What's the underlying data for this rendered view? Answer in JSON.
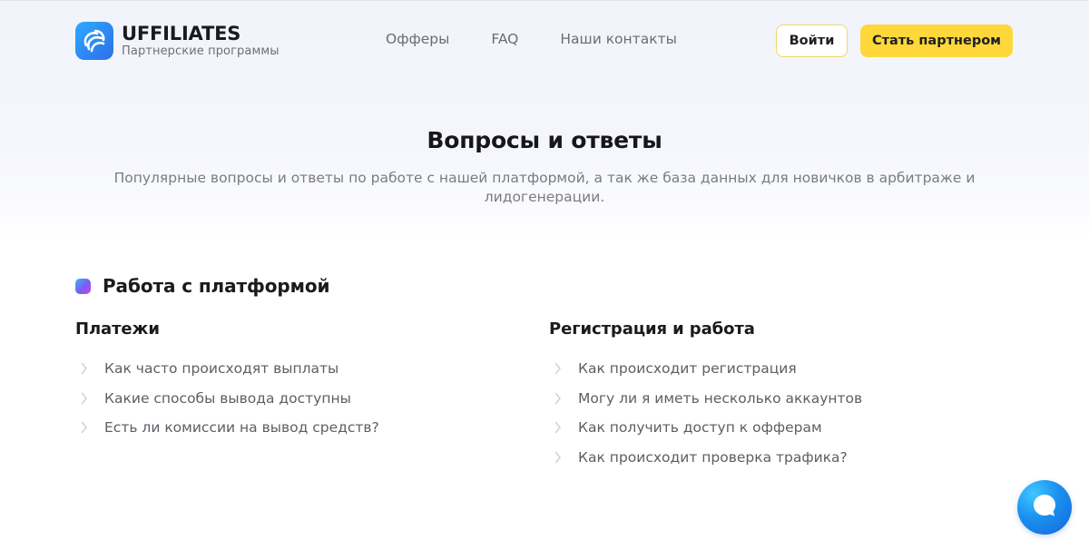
{
  "header": {
    "logo_title": "UFFILIATES",
    "logo_subtitle": "Партнерские программы",
    "nav": [
      "Офферы",
      "FAQ",
      "Наши контакты"
    ],
    "login_label": "Войти",
    "partner_label": "Стать партнером"
  },
  "hero": {
    "title": "Вопросы и ответы",
    "subtitle": "Популярные вопросы и ответы по работе с нашей платформой, а так же база данных для новичков в арбитраже и лидогенерации."
  },
  "section": {
    "title": "Работа с платформой",
    "columns": [
      {
        "title": "Платежи",
        "items": [
          "Как часто происходят выплаты",
          "Какие способы вывода доступны",
          "Есть ли комиссии на вывод средств?"
        ]
      },
      {
        "title": "Регистрация и работа",
        "items": [
          "Как происходит регистрация",
          "Могу ли я иметь несколько аккаунтов",
          "Как получить доступ к офферам",
          "Как происходит проверка трафика?"
        ]
      }
    ]
  },
  "icons": {
    "logo": "logo-icon",
    "bullet": "chevron-right-icon",
    "chat": "chat-bubble-icon",
    "section": "section-marker-icon"
  },
  "colors": {
    "accent_yellow": "#fed83a",
    "login_border": "#f2d766",
    "logo_blue": "#2b8df0",
    "chat_blue": "#1b8ff0"
  }
}
